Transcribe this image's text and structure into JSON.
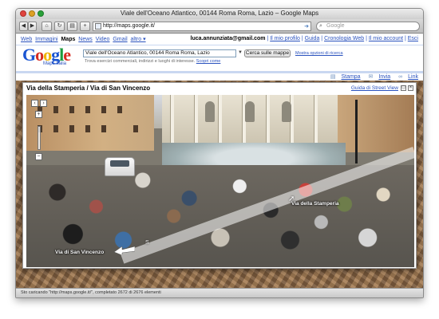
{
  "window": {
    "title": "Viale dell'Oceano Atlantico, 00144 Roma Roma, Lazio – Google Maps"
  },
  "toolbar": {
    "url": "http://maps.google.it/",
    "search_placeholder": "Google",
    "back_icon": "back-arrow",
    "forward_icon": "forward-arrow",
    "home_icon": "home",
    "reload_icon": "reload",
    "print_icon": "print",
    "add_icon": "plus"
  },
  "gbar": {
    "links": [
      "Web",
      "Immagini",
      "Maps",
      "News",
      "Video",
      "Gmail",
      "altro ▾"
    ],
    "current": "Maps",
    "email": "luca.annunziata@gmail.com",
    "account_links": [
      "Il mio profilo",
      "Guida",
      "Cronologia Web",
      "Il mio account",
      "Esci"
    ]
  },
  "logo": {
    "letters": [
      "G",
      "o",
      "o",
      "g",
      "l",
      "e"
    ],
    "colors": [
      "#1a55d2",
      "#d62b20",
      "#f0b400",
      "#1a55d2",
      "#1a9c3e",
      "#d62b20"
    ],
    "subtitle": "Maps Italia"
  },
  "search": {
    "value": "Viale dell'Oceano Atlantico, 00144 Roma Roma, Lazio",
    "button": "Cerca sulle mappe",
    "options_link": "Mostra opzioni di ricerca",
    "hint": "Trova esercizi commerciali, indirizzi e luoghi di interesse.",
    "hint_link": "Scopri come"
  },
  "actions": {
    "print": "Stampa",
    "send": "Invia",
    "link": "Link"
  },
  "streetview": {
    "title": "Via della Stamperia / Via di San Vincenzo",
    "guide_link": "Guida di Street View",
    "street_ne": "Via della Stamperia",
    "street_sw": "Via di San Vincenzo",
    "compass_letter": "S",
    "zoom_in": "+",
    "zoom_out": "−"
  },
  "statusbar": {
    "text": "Sto caricando \"http://maps.google.it/\", completato 2672 di 2676 elementi"
  }
}
